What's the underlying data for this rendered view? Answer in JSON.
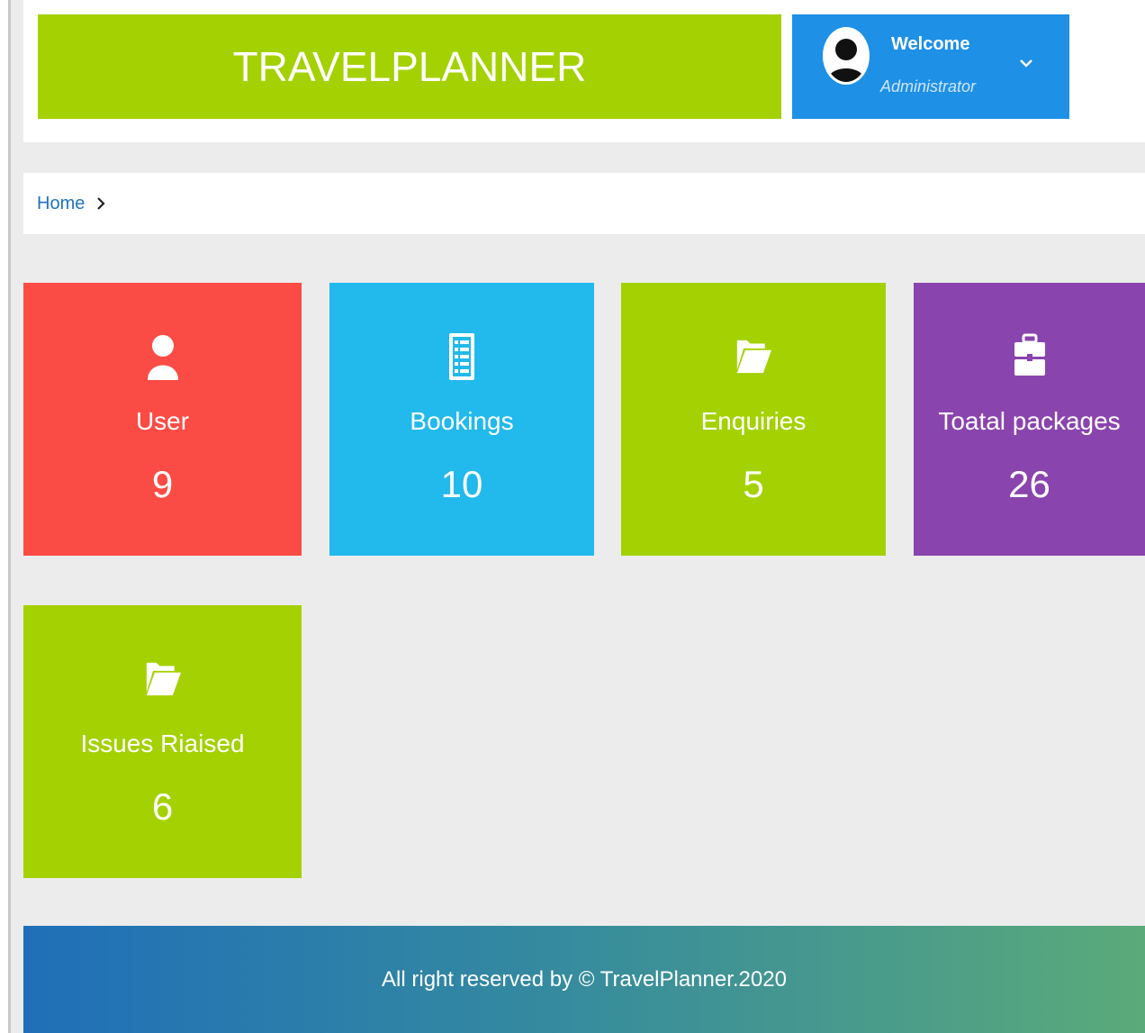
{
  "header": {
    "logo_text": "TRAVELPLANNER",
    "welcome": "Welcome",
    "role": "Administrator"
  },
  "breadcrumb": {
    "home": "Home"
  },
  "tiles": [
    {
      "label": "User",
      "count": "9",
      "icon": "user-icon",
      "color": "#fb4b45"
    },
    {
      "label": "Bookings",
      "count": "10",
      "icon": "list-icon",
      "color": "#22b9ec"
    },
    {
      "label": "Enquiries",
      "count": "5",
      "icon": "folder-open-icon",
      "color": "#a4d102"
    },
    {
      "label": "Toatal packages",
      "count": "26",
      "icon": "briefcase-icon",
      "color": "#8a44ae"
    },
    {
      "label": "Issues Riaised",
      "count": "6",
      "icon": "folder-open-icon",
      "color": "#a4d102"
    }
  ],
  "footer": {
    "text": "All right reserved by © TravelPlanner.2020"
  },
  "colors": {
    "brand_green": "#a4d102",
    "profile_blue": "#1e90e6",
    "background": "#ececec"
  }
}
